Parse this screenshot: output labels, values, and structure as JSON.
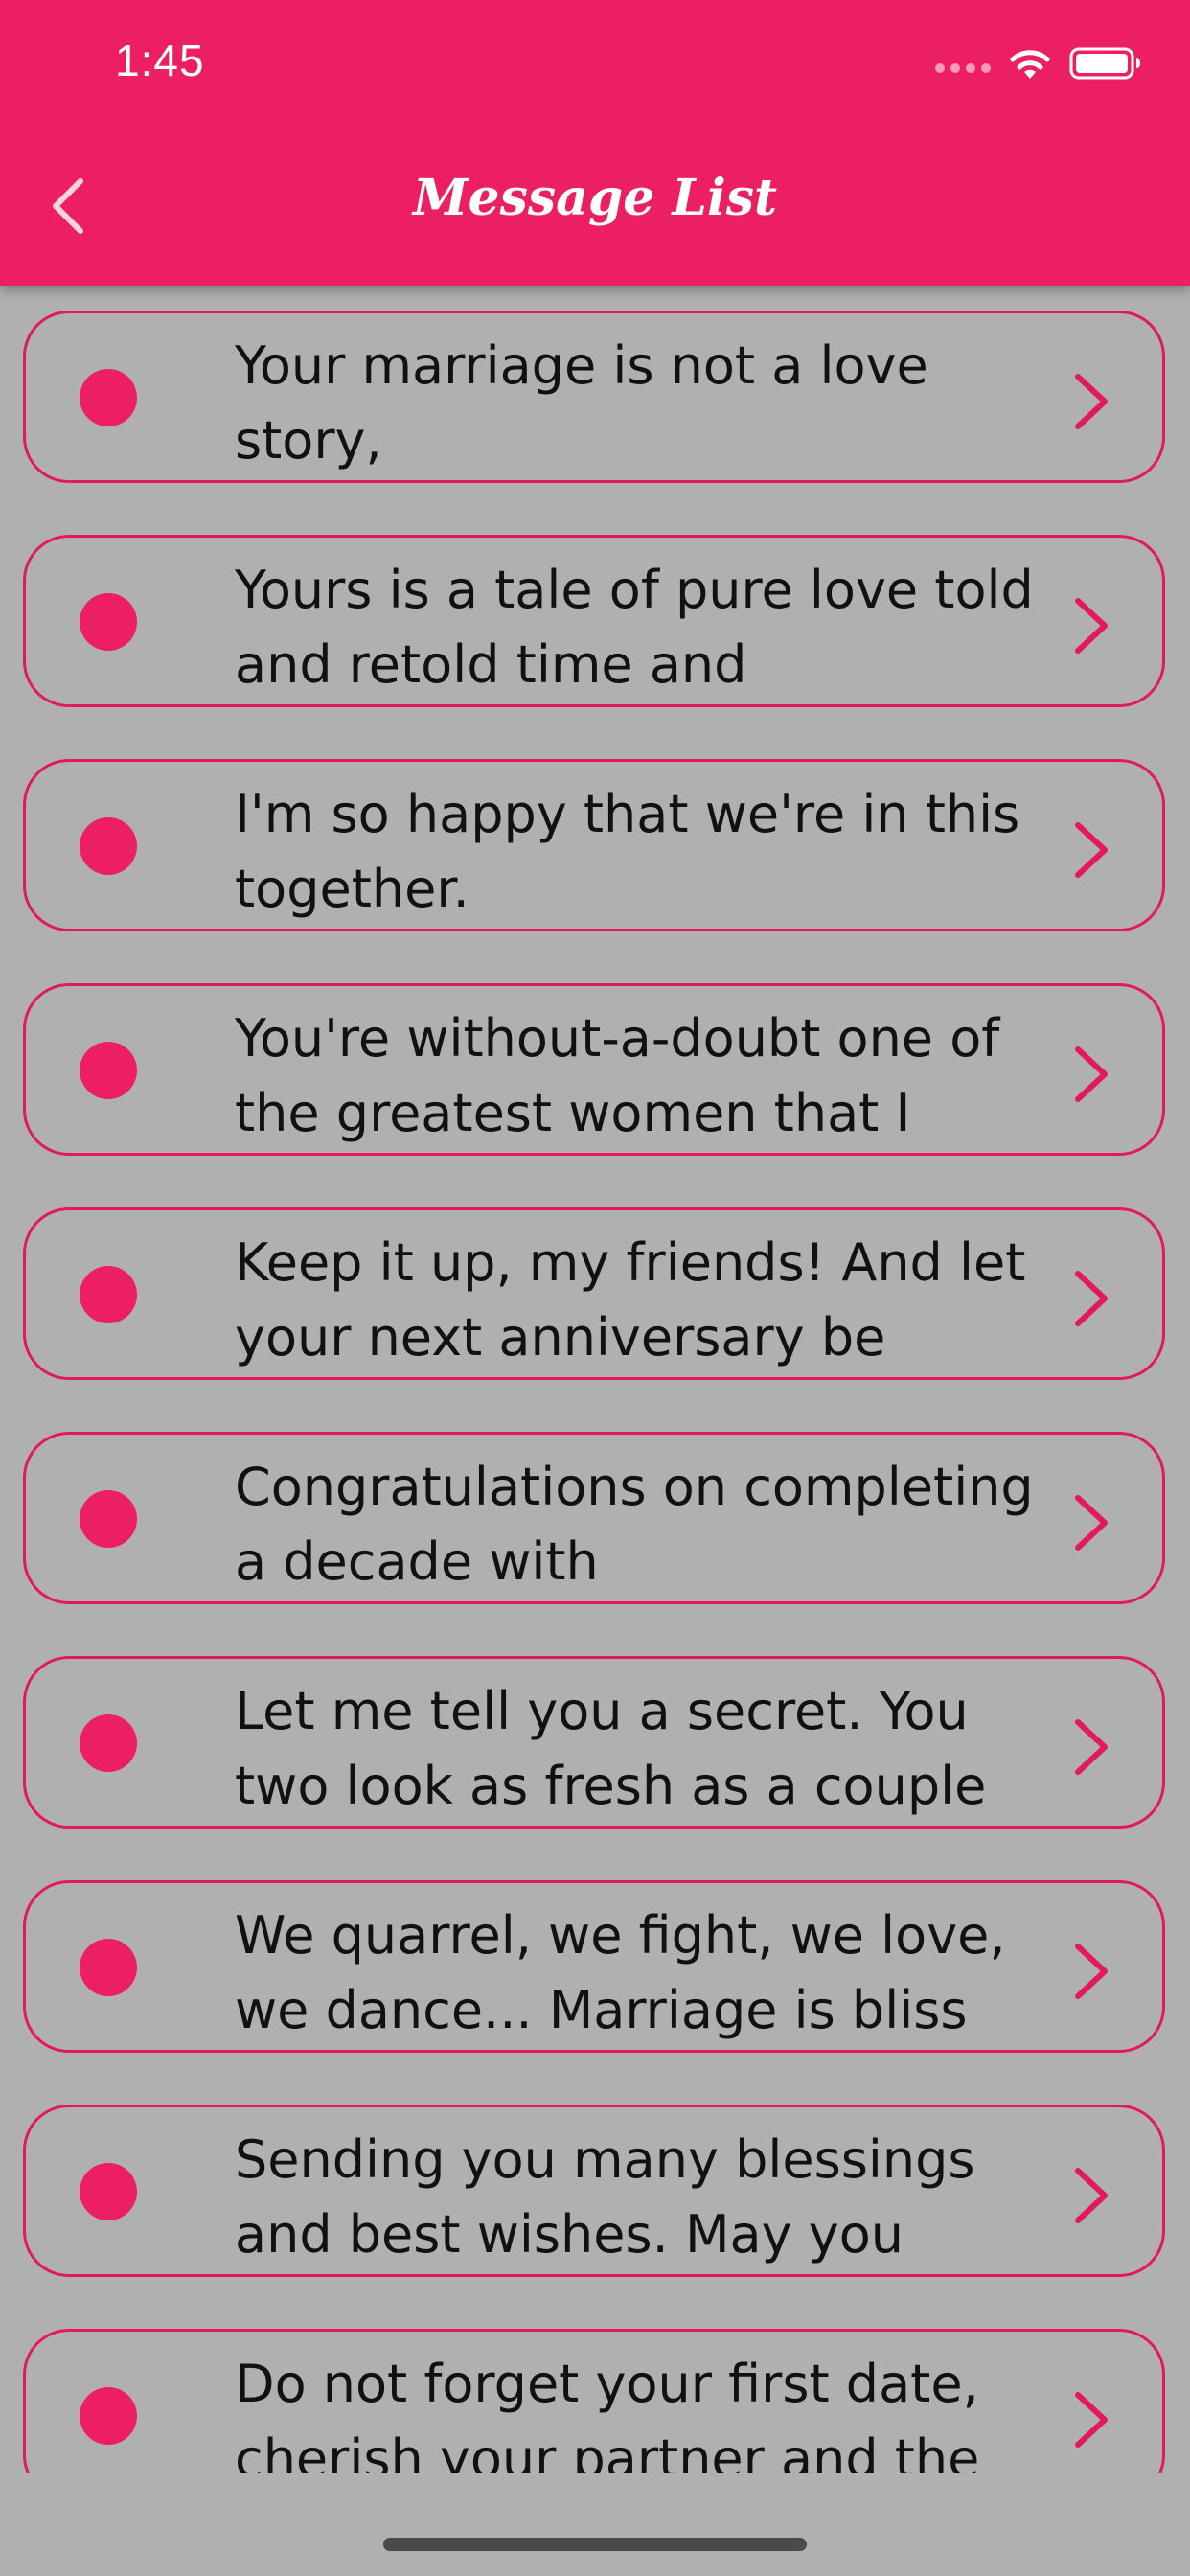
{
  "status_bar": {
    "time": "1:45"
  },
  "header": {
    "title": "Message List",
    "back_icon": "chevron-left-icon"
  },
  "colors": {
    "primary": "#ec1f63",
    "background": "#b0b0b0",
    "text": "#111111"
  },
  "messages": [
    {
      "text": "Your marriage is not a love story,"
    },
    {
      "text": "Yours is a tale of pure love told and retold time and"
    },
    {
      "text": "I'm so happy that we're in this together."
    },
    {
      "text": "You're without-a-doubt one of the greatest women that I"
    },
    {
      "text": "Keep it up, my friends! And let your next anniversary be"
    },
    {
      "text": "Congratulations on completing a decade with"
    },
    {
      "text": "Let me tell you a secret. You two look as fresh as a couple"
    },
    {
      "text": "We quarrel, we fight, we love, we dance... Marriage is bliss"
    },
    {
      "text": "Sending you many blessings and best wishes. May you"
    },
    {
      "text": "Do not forget your first date, cherish your partner and the"
    }
  ]
}
